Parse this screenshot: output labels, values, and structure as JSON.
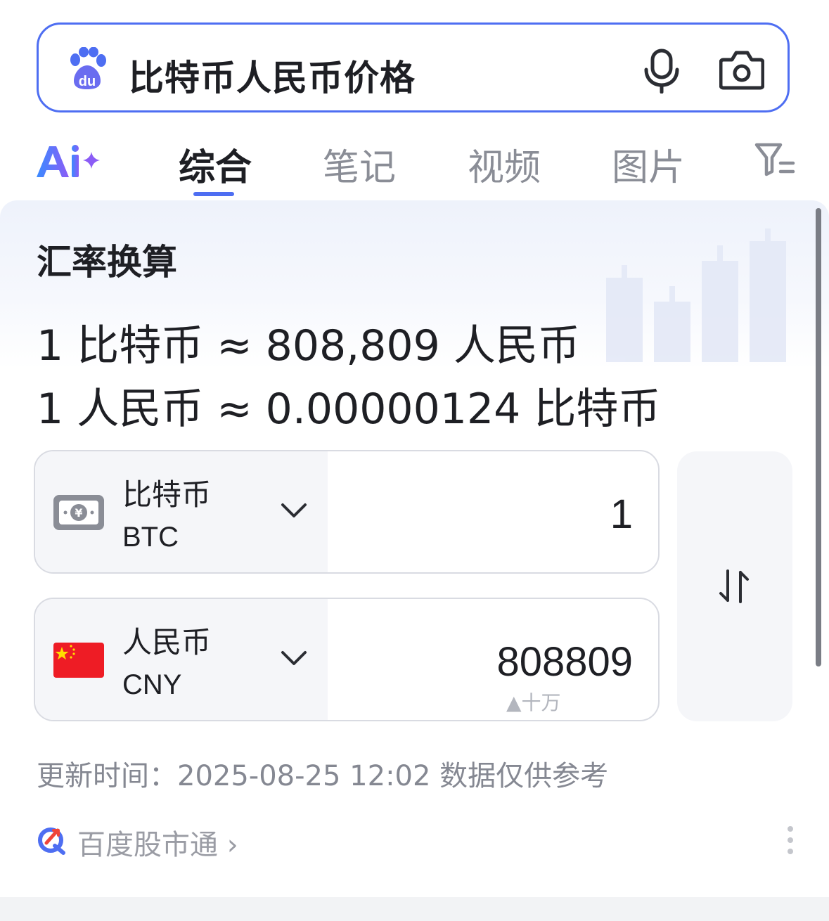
{
  "search": {
    "query": "比特币人民币价格"
  },
  "tabs": [
    {
      "label": "综合",
      "active": true
    },
    {
      "label": "笔记",
      "active": false
    },
    {
      "label": "视频",
      "active": false
    },
    {
      "label": "图片",
      "active": false
    }
  ],
  "card": {
    "title": "汇率换算",
    "rate_line_1": "1 比特币 ≈ 808,809 人民币",
    "rate_line_2": "1 人民币 ≈ 0.00000124 比特币",
    "from": {
      "name": "比特币",
      "code": "BTC",
      "amount": "1",
      "icon": "banknote-yen-icon"
    },
    "to": {
      "name": "人民币",
      "code": "CNY",
      "amount": "808809",
      "unit_hint": "▲十万",
      "icon": "china-flag-icon"
    },
    "update_time": "更新时间：2025-08-25 12:02 数据仅供参考",
    "source": "百度股市通 ›"
  },
  "colors": {
    "accent": "#4e6ef2",
    "flag_red": "#ee1c25",
    "flag_star": "#ffde00"
  }
}
